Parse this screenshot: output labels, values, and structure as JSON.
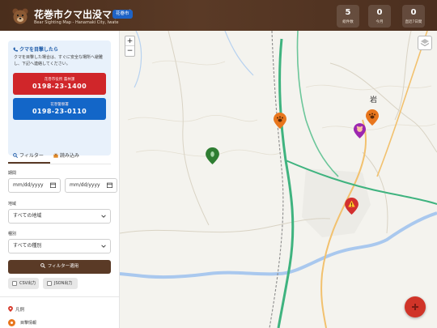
{
  "header": {
    "title": "花巻市クマ出没マップ",
    "badge": "花巻市",
    "subtitle": "Bear Sighting Map - Hanamaki City, Iwate",
    "stats": [
      {
        "value": "5",
        "label": "総件数"
      },
      {
        "value": "0",
        "label": "今月"
      },
      {
        "value": "0",
        "label": "直近7日間"
      }
    ]
  },
  "sidebar": {
    "alert": {
      "title": "クマを目撃したら",
      "text": "クマを目撃した場合は、すぐに安全な場所へ避難し、下記へ連絡してください。",
      "contacts": [
        {
          "label": "花巻市役所 農林課",
          "number": "0198-23-1400",
          "color": "#d0262a"
        },
        {
          "label": "花巻警察署",
          "number": "0198-23-0110",
          "color": "#1366c8"
        }
      ]
    },
    "tabs": [
      {
        "label": "フィルター",
        "icon": "search-icon"
      },
      {
        "label": "読み込み",
        "icon": "inbox-icon"
      }
    ],
    "filters": {
      "period_label": "期間",
      "date_from": "mm/dd/yyyy",
      "date_to": "mm/dd/yyyy",
      "area_label": "地域",
      "area_value": "すべての地域",
      "type_label": "種別",
      "type_value": "すべての種別",
      "apply_label": "フィルター適用",
      "csv_label": "CSV出力",
      "json_label": "JSON出力"
    },
    "legend": {
      "title": "凡例",
      "items": [
        {
          "label": "目撃情報",
          "color": "#e8761d"
        }
      ]
    }
  },
  "map": {
    "zoom_in": "+",
    "zoom_out": "−",
    "place_label": "岩",
    "markers": [
      {
        "type": "sighting",
        "color": "#e8761d",
        "icon": "paw-icon"
      },
      {
        "type": "sighting",
        "color": "#e8761d",
        "icon": "paw-icon"
      },
      {
        "type": "damage",
        "color": "#9c27b0",
        "icon": "bear-icon"
      },
      {
        "type": "trace",
        "color": "#2e7d32",
        "icon": "leaf-icon"
      },
      {
        "type": "danger",
        "color": "#d32f2f",
        "icon": "warning-icon"
      }
    ]
  },
  "colors": {
    "brand": "#5a3a26",
    "accent_blue": "#1366c8",
    "accent_red": "#d0262a",
    "road_green": "#3fb37f"
  }
}
